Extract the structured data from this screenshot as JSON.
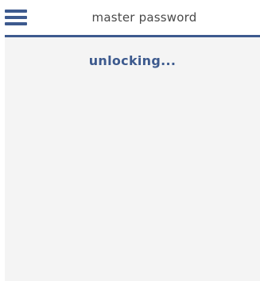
{
  "header": {
    "menu_icon": "hamburger-menu-icon",
    "title": "master password"
  },
  "main": {
    "status_text": "unlocking..."
  },
  "colors": {
    "accent": "#3d5a8e",
    "title_text": "#4a4a4a",
    "content_background": "#f4f4f4"
  }
}
